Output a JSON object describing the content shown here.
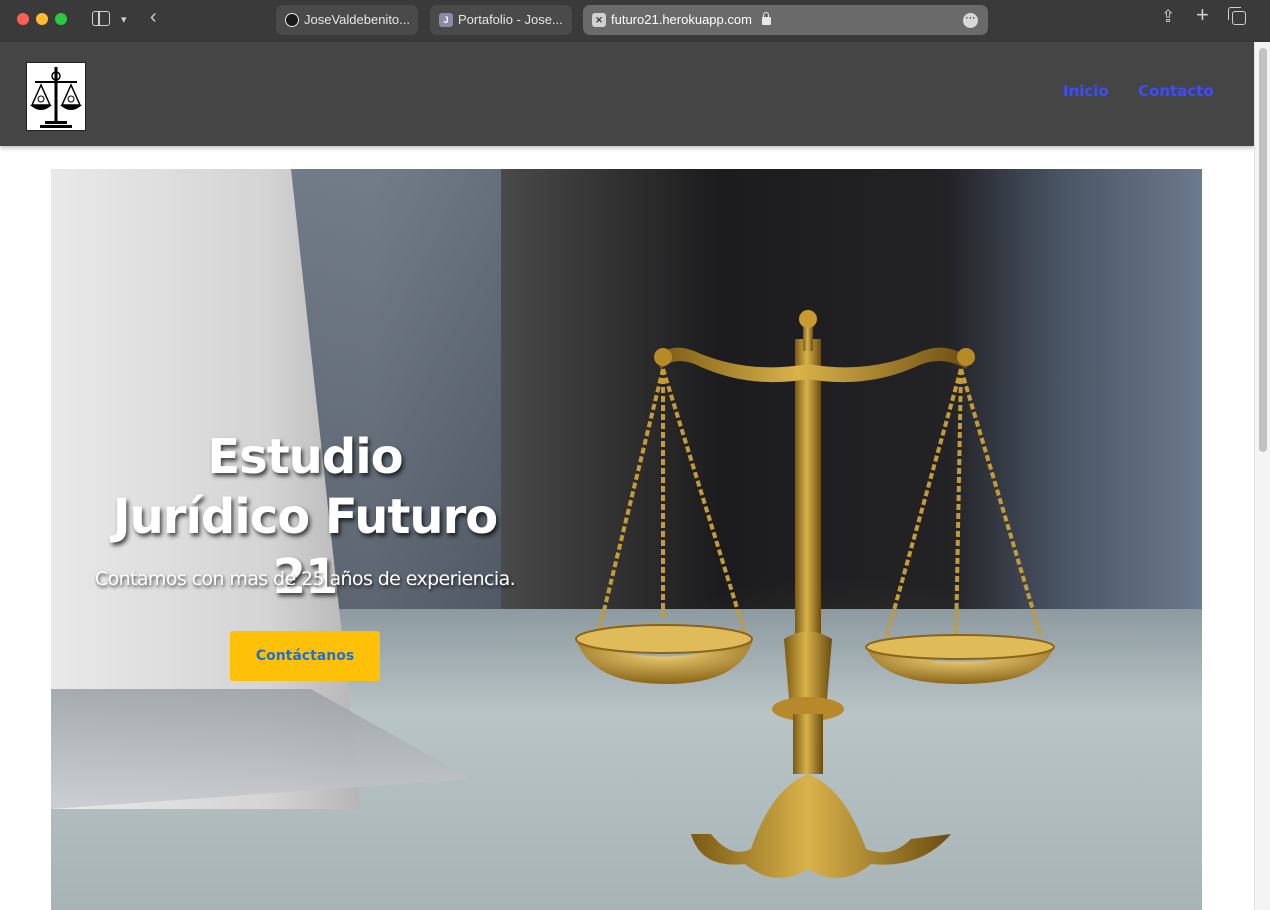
{
  "browser": {
    "tabs": [
      {
        "label": "JoseValdebenito...",
        "favicon": "github-icon"
      },
      {
        "label": "Portafolio - Jose...",
        "favicon_text": "J"
      },
      {
        "label": "futuro21.herokuapp.com",
        "favicon": "close-icon",
        "active": true
      }
    ],
    "colors": {
      "chrome_bg": "#3a3a3a",
      "active_tab": "#6a6a6a"
    }
  },
  "header": {
    "logo": "scales-of-justice-logo",
    "nav": [
      {
        "label": "Inicio"
      },
      {
        "label": "Contacto"
      }
    ],
    "colors": {
      "background": "#454545",
      "nav_link": "#3d4cff"
    }
  },
  "hero": {
    "title": "Estudio Jurídico Futuro 21",
    "subtitle": "Contamos con mas de 25 años de experiencia.",
    "cta_label": "Contáctanos",
    "image": "golden-scales-of-justice-photo",
    "colors": {
      "cta_bg": "#ffc107",
      "cta_text": "#1f6fd6",
      "title": "#ffffff"
    }
  }
}
